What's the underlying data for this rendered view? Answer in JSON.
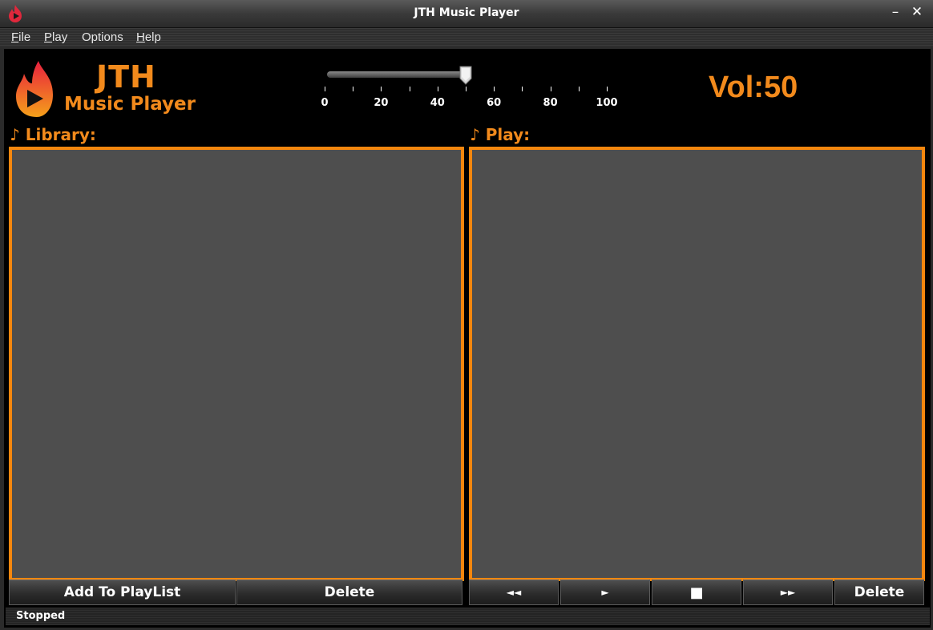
{
  "window": {
    "title": "JTH Music Player",
    "minimize": "–",
    "close": "✕"
  },
  "menu": [
    {
      "first": "F",
      "rest": "ile"
    },
    {
      "first": "P",
      "rest": "lay"
    },
    {
      "first": "O",
      "rest": "ptions"
    },
    {
      "first": "H",
      "rest": "elp"
    }
  ],
  "logo": {
    "line1": "JTH",
    "line2": "Music Player"
  },
  "volume": {
    "value": 50,
    "min": 0,
    "max": 100,
    "ticks": [
      "0",
      "20",
      "40",
      "60",
      "80",
      "100"
    ],
    "label": "Vol:",
    "display": "50"
  },
  "library": {
    "title": "♪ Library:",
    "add_label": "Add To PlayList",
    "delete_label": "Delete"
  },
  "playlist": {
    "title": "♪ Play:",
    "prev_label": "◄◄",
    "play_label": "►",
    "stop_label": "■",
    "next_label": "►►",
    "delete_label": "Delete"
  },
  "status": {
    "text": "Stopped"
  },
  "colors": {
    "accent": "#f28a1c",
    "panel": "#4e4e4e",
    "background": "#000000"
  },
  "icons": {
    "app": "flame-play-icon",
    "thumb": "slider-thumb-icon"
  }
}
